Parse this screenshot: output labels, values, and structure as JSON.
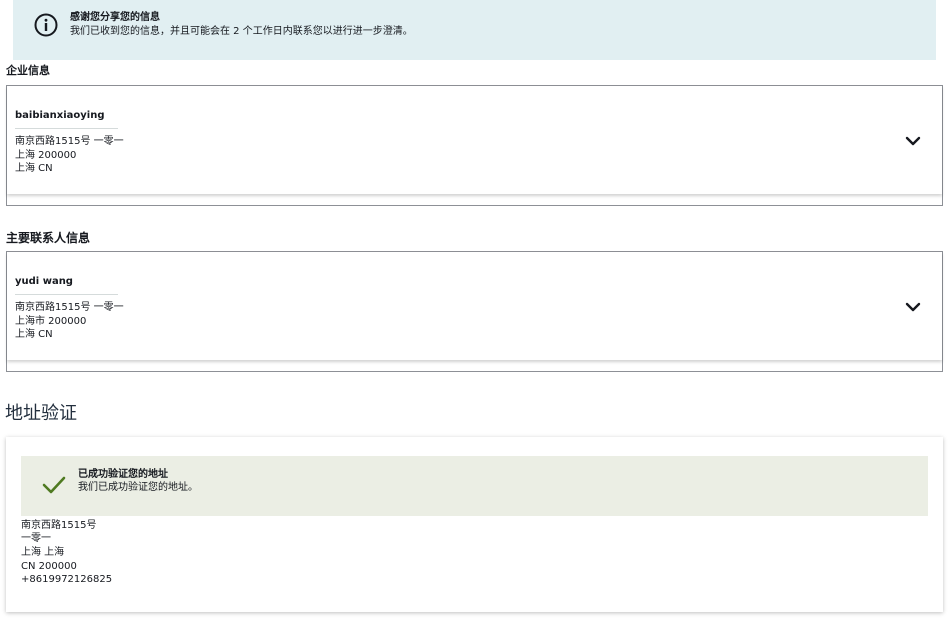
{
  "info_banner": {
    "icon": "info-icon",
    "title": "感谢您分享您的信息",
    "message": "我们已收到您的信息，并且可能会在 2 个工作日内联系您以进行进一步澄清。",
    "background": "#e1eff2"
  },
  "company_section": {
    "heading": "企业信息",
    "name": "baibianxiaoying",
    "address_lines": [
      "南京西路1515号 一零一",
      "上海 200000",
      "上海 CN"
    ],
    "expand_icon": "chevron-down-icon"
  },
  "contact_section": {
    "heading": "主要联系人信息",
    "name": "yudi wang",
    "address_lines": [
      "南京西路1515号 一零一",
      "上海市 200000",
      "上海 CN"
    ],
    "expand_icon": "chevron-down-icon"
  },
  "address_verification": {
    "heading": "地址验证",
    "alert": {
      "icon": "checkmark-icon",
      "title": "已成功验证您的地址",
      "message": "我们已成功验证您的地址。",
      "background": "#ebeee4",
      "icon_color": "#4f7a21"
    },
    "verified_address_lines": [
      "南京西路1515号",
      "一零一",
      "上海 上海",
      "CN 200000",
      "+8619972126825"
    ]
  }
}
